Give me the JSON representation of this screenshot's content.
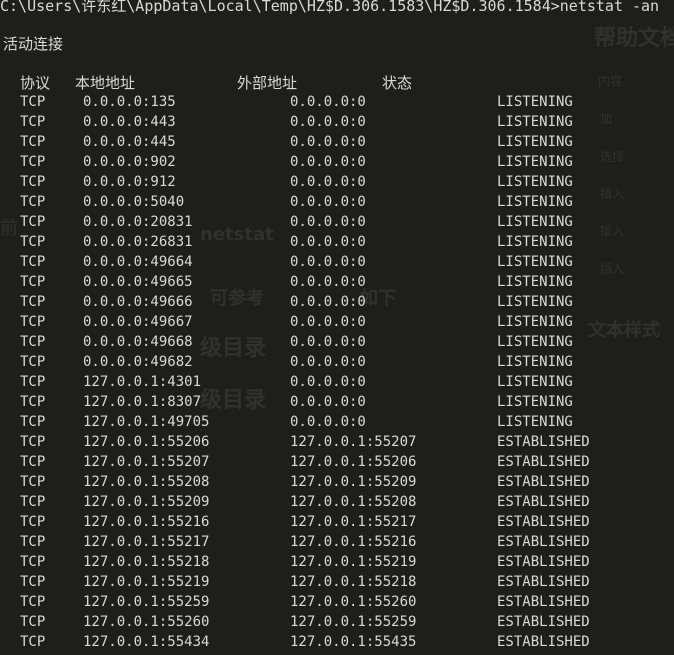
{
  "window": {
    "command_line": "C:\\Users\\许东红\\AppData\\Local\\Temp\\HZ$D.306.1583\\HZ$D.306.1584>netstat -an"
  },
  "section": {
    "title": "活动连接"
  },
  "table": {
    "headers": {
      "protocol": "协议",
      "local": "本地地址",
      "foreign": "外部地址",
      "state": "状态"
    },
    "rows": [
      {
        "protocol": "TCP",
        "local": "0.0.0.0:135",
        "foreign": "0.0.0.0:0",
        "state": "LISTENING"
      },
      {
        "protocol": "TCP",
        "local": "0.0.0.0:443",
        "foreign": "0.0.0.0:0",
        "state": "LISTENING"
      },
      {
        "protocol": "TCP",
        "local": "0.0.0.0:445",
        "foreign": "0.0.0.0:0",
        "state": "LISTENING"
      },
      {
        "protocol": "TCP",
        "local": "0.0.0.0:902",
        "foreign": "0.0.0.0:0",
        "state": "LISTENING"
      },
      {
        "protocol": "TCP",
        "local": "0.0.0.0:912",
        "foreign": "0.0.0.0:0",
        "state": "LISTENING"
      },
      {
        "protocol": "TCP",
        "local": "0.0.0.0:5040",
        "foreign": "0.0.0.0:0",
        "state": "LISTENING"
      },
      {
        "protocol": "TCP",
        "local": "0.0.0.0:20831",
        "foreign": "0.0.0.0:0",
        "state": "LISTENING"
      },
      {
        "protocol": "TCP",
        "local": "0.0.0.0:26831",
        "foreign": "0.0.0.0:0",
        "state": "LISTENING"
      },
      {
        "protocol": "TCP",
        "local": "0.0.0.0:49664",
        "foreign": "0.0.0.0:0",
        "state": "LISTENING"
      },
      {
        "protocol": "TCP",
        "local": "0.0.0.0:49665",
        "foreign": "0.0.0.0:0",
        "state": "LISTENING"
      },
      {
        "protocol": "TCP",
        "local": "0.0.0.0:49666",
        "foreign": "0.0.0.0:0",
        "state": "LISTENING"
      },
      {
        "protocol": "TCP",
        "local": "0.0.0.0:49667",
        "foreign": "0.0.0.0:0",
        "state": "LISTENING"
      },
      {
        "protocol": "TCP",
        "local": "0.0.0.0:49668",
        "foreign": "0.0.0.0:0",
        "state": "LISTENING"
      },
      {
        "protocol": "TCP",
        "local": "0.0.0.0:49682",
        "foreign": "0.0.0.0:0",
        "state": "LISTENING"
      },
      {
        "protocol": "TCP",
        "local": "127.0.0.1:4301",
        "foreign": "0.0.0.0:0",
        "state": "LISTENING"
      },
      {
        "protocol": "TCP",
        "local": "127.0.0.1:8307",
        "foreign": "0.0.0.0:0",
        "state": "LISTENING"
      },
      {
        "protocol": "TCP",
        "local": "127.0.0.1:49705",
        "foreign": "0.0.0.0:0",
        "state": "LISTENING"
      },
      {
        "protocol": "TCP",
        "local": "127.0.0.1:55206",
        "foreign": "127.0.0.1:55207",
        "state": "ESTABLISHED"
      },
      {
        "protocol": "TCP",
        "local": "127.0.0.1:55207",
        "foreign": "127.0.0.1:55206",
        "state": "ESTABLISHED"
      },
      {
        "protocol": "TCP",
        "local": "127.0.0.1:55208",
        "foreign": "127.0.0.1:55209",
        "state": "ESTABLISHED"
      },
      {
        "protocol": "TCP",
        "local": "127.0.0.1:55209",
        "foreign": "127.0.0.1:55208",
        "state": "ESTABLISHED"
      },
      {
        "protocol": "TCP",
        "local": "127.0.0.1:55216",
        "foreign": "127.0.0.1:55217",
        "state": "ESTABLISHED"
      },
      {
        "protocol": "TCP",
        "local": "127.0.0.1:55217",
        "foreign": "127.0.0.1:55216",
        "state": "ESTABLISHED"
      },
      {
        "protocol": "TCP",
        "local": "127.0.0.1:55218",
        "foreign": "127.0.0.1:55219",
        "state": "ESTABLISHED"
      },
      {
        "protocol": "TCP",
        "local": "127.0.0.1:55219",
        "foreign": "127.0.0.1:55218",
        "state": "ESTABLISHED"
      },
      {
        "protocol": "TCP",
        "local": "127.0.0.1:55259",
        "foreign": "127.0.0.1:55260",
        "state": "ESTABLISHED"
      },
      {
        "protocol": "TCP",
        "local": "127.0.0.1:55260",
        "foreign": "127.0.0.1:55259",
        "state": "ESTABLISHED"
      },
      {
        "protocol": "TCP",
        "local": "127.0.0.1:55434",
        "foreign": "127.0.0.1:55435",
        "state": "ESTABLISHED"
      }
    ]
  },
  "background": {
    "right_heading_1": "帮助文档",
    "right_heading_2": "文本样式",
    "left_fragment": "前",
    "right_short_1": "内容",
    "right_short_2": "加",
    "right_short_3": "选择",
    "right_short_4": "插入",
    "right_short_5": "插入",
    "right_short_6": "插入",
    "mid_heading_1": "级目录",
    "mid_heading_2": "级目录",
    "mid_text_1": "netstat",
    "mid_text_2": "可参考",
    "mid_text_3": "如下",
    "colors": {
      "background": "#1e1f1b",
      "foreground": "#d9d9d9"
    }
  }
}
